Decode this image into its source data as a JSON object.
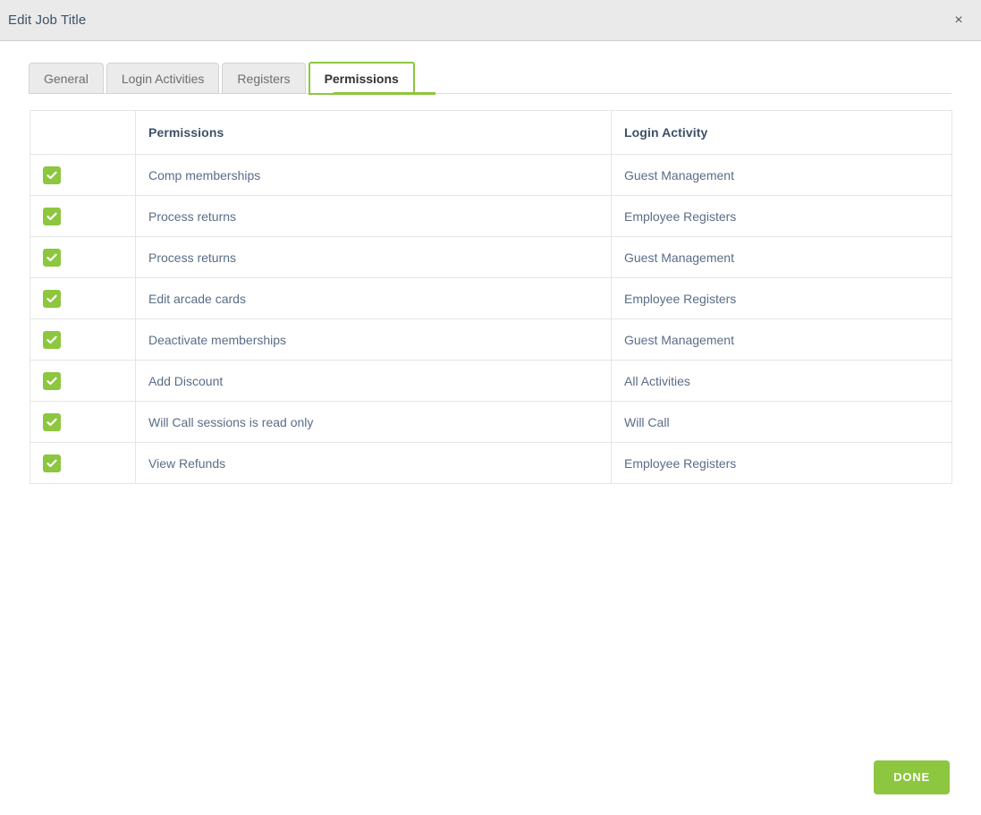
{
  "dialog": {
    "title": "Edit Job Title",
    "close_label": "×"
  },
  "tabs": [
    {
      "label": "General",
      "active": false
    },
    {
      "label": "Login Activities",
      "active": false
    },
    {
      "label": "Registers",
      "active": false
    },
    {
      "label": "Permissions",
      "active": true
    }
  ],
  "table": {
    "headers": {
      "checkbox": "",
      "permissions": "Permissions",
      "login_activity": "Login Activity"
    },
    "rows": [
      {
        "checked": true,
        "permission": "Comp memberships",
        "login_activity": "Guest Management"
      },
      {
        "checked": true,
        "permission": "Process returns",
        "login_activity": "Employee Registers"
      },
      {
        "checked": true,
        "permission": "Process returns",
        "login_activity": "Guest Management"
      },
      {
        "checked": true,
        "permission": "Edit arcade cards",
        "login_activity": "Employee Registers"
      },
      {
        "checked": true,
        "permission": "Deactivate memberships",
        "login_activity": "Guest Management"
      },
      {
        "checked": true,
        "permission": "Add Discount",
        "login_activity": "All Activities"
      },
      {
        "checked": true,
        "permission": "Will Call sessions is read only",
        "login_activity": "Will Call"
      },
      {
        "checked": true,
        "permission": "View Refunds",
        "login_activity": "Employee Registers"
      }
    ]
  },
  "footer": {
    "done_label": "DONE"
  },
  "colors": {
    "accent_green": "#8dc63f",
    "title_text": "#3c5168",
    "body_text": "#5a6d86",
    "header_bg": "#eaeaea",
    "border": "#e3e5e8"
  }
}
